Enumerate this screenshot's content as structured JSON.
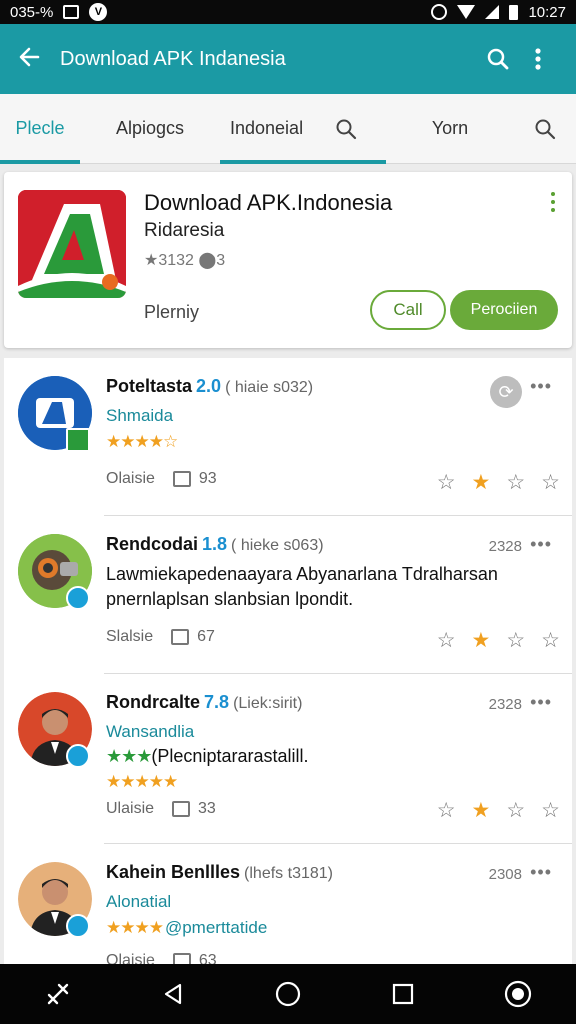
{
  "status_bar": {
    "time_left": "035-%",
    "time_right": "10:27"
  },
  "app_bar": {
    "title": "Download APK Indanesia"
  },
  "tabs": [
    {
      "label": "Plecle",
      "active": true
    },
    {
      "label": "Alpiogcs",
      "active": false
    },
    {
      "label": "Indoneial",
      "active": false
    },
    {
      "label": "Yorn",
      "active": false
    }
  ],
  "app_card": {
    "title": "Download APK.Indonesia",
    "subtitle": "Ridaresia",
    "meta": "★3132 ⬤3",
    "price_label": "Plerniy",
    "button_outline": "Call",
    "button_fill": "Perociien"
  },
  "reviews": [
    {
      "name": "Poteltasta",
      "version": "2.0",
      "meta": "( hiaie s032)",
      "tag": "Shmaida",
      "stars": "★★★★☆",
      "date": "",
      "body_1": "",
      "body_2": "",
      "foot_label": "Olaisie",
      "likes": "93",
      "rating": 2
    },
    {
      "name": "Rendcodai",
      "version": "1.8",
      "meta": "( hieke s063)",
      "tag": "",
      "stars": "",
      "date": "2328",
      "body_1": "Lawmiekapedenaayara Abyanarlana Tdralharsan",
      "body_2": "pnernlaplsan slanbsian lpondit.",
      "foot_label": "Slalsie",
      "likes": "67",
      "rating": 2
    },
    {
      "name": "Rondrcalte",
      "version": "7.8",
      "meta": "(Liek:sirit)",
      "tag": "Wansandlia",
      "stars_green": "★★★",
      "stars_green_text": "(Plecniptararastalill.",
      "stars": "★★★★★",
      "date": "2328",
      "body_1": "",
      "body_2": "",
      "foot_label": "Ulaisie",
      "likes": "33",
      "rating": 2
    },
    {
      "name": "Kahein Benllles",
      "version": "",
      "meta": "(lhefs t3181)",
      "tag": "Alonatial",
      "stars": "★★★★",
      "stars_text": "@pmerttatide",
      "date": "2308",
      "body_1": "",
      "body_2": "",
      "foot_label": "Olaisie",
      "likes": "63",
      "rating": 2
    }
  ],
  "colors": {
    "primary": "#1b9aa4",
    "accent_green": "#6aaa3a",
    "star": "#f0a020"
  }
}
